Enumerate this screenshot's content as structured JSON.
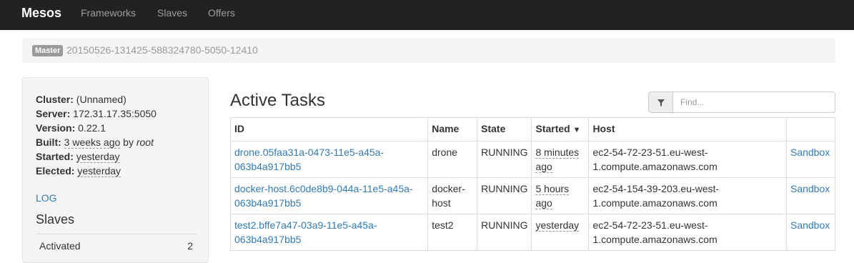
{
  "navbar": {
    "brand": "Mesos",
    "links": [
      "Frameworks",
      "Slaves",
      "Offers"
    ]
  },
  "breadcrumb": {
    "badge": "Master",
    "master_id": "20150526-131425-588324780-5050-12410"
  },
  "sidebar": {
    "cluster_label": "Cluster:",
    "cluster_value": "(Unnamed)",
    "server_label": "Server:",
    "server_value": "172.31.17.35:5050",
    "version_label": "Version:",
    "version_value": "0.22.1",
    "built_label": "Built:",
    "built_value": "3 weeks ago",
    "built_by": "by",
    "built_user": "root",
    "started_label": "Started:",
    "started_value": "yesterday",
    "elected_label": "Elected:",
    "elected_value": "yesterday",
    "log_link": "LOG",
    "slaves_heading": "Slaves",
    "slaves_rows": [
      {
        "label": "Activated",
        "value": "2"
      }
    ]
  },
  "tasks": {
    "title": "Active Tasks",
    "filter_placeholder": "Find...",
    "columns": [
      "ID",
      "Name",
      "State",
      "Started",
      "Host",
      ""
    ],
    "sort_indicator": "▼",
    "rows": [
      {
        "id_line1": "drone.05faa31a-0473-11e5-a45a-",
        "id_line2": "063b4a917bb5",
        "name_line1": "drone",
        "name_line2": "",
        "state": "RUNNING",
        "started_line1": "8 minutes",
        "started_line2": "ago",
        "host_line1": "ec2-54-72-23-51.eu-west-",
        "host_line2": "1.compute.amazonaws.com",
        "action": "Sandbox"
      },
      {
        "id_line1": "docker-host.6c0de8b9-044a-11e5-a45a-",
        "id_line2": "063b4a917bb5",
        "name_line1": "docker-",
        "name_line2": "host",
        "state": "RUNNING",
        "started_line1": "5 hours",
        "started_line2": "ago",
        "host_line1": "ec2-54-154-39-203.eu-west-",
        "host_line2": "1.compute.amazonaws.com",
        "action": "Sandbox"
      },
      {
        "id_line1": "test2.bffe7a47-03a9-11e5-a45a-",
        "id_line2": "063b4a917bb5",
        "name_line1": "test2",
        "name_line2": "",
        "state": "RUNNING",
        "started_line1": "yesterday",
        "started_line2": "",
        "host_line1": "ec2-54-72-23-51.eu-west-",
        "host_line2": "1.compute.amazonaws.com",
        "action": "Sandbox"
      }
    ]
  },
  "colors": {
    "navbar_bg": "#222222",
    "link": "#337ab7",
    "muted": "#999999"
  }
}
